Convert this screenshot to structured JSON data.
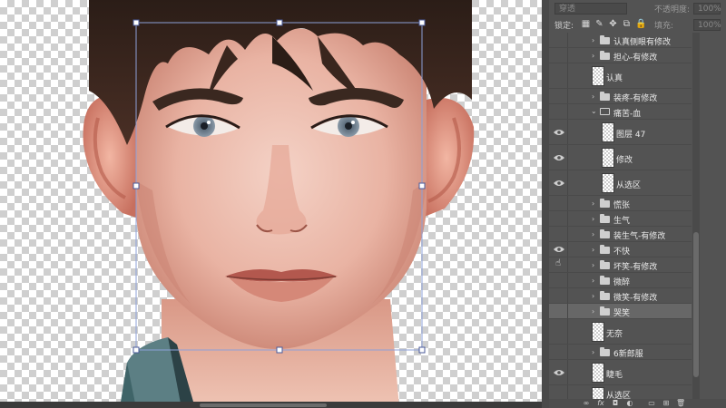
{
  "canvas": {
    "portrait": "illustrated male portrait",
    "transform_box": true
  },
  "panel": {
    "blend_mode": "穿透",
    "opacity_label": "不透明度:",
    "opacity_value": "100%",
    "lock_label": "锁定:",
    "fill_label": "填充:",
    "fill_value": "100%",
    "layers": [
      {
        "name": "认真侧眼有修改",
        "kind": "group",
        "visible": false,
        "expanded": false
      },
      {
        "name": "担心-有修改",
        "kind": "group",
        "visible": false,
        "expanded": false
      },
      {
        "name": "认真",
        "kind": "layer",
        "visible": false
      },
      {
        "name": "装疼-有修改",
        "kind": "group",
        "visible": false,
        "expanded": false
      },
      {
        "name": "痛苦-血",
        "kind": "group",
        "visible": false,
        "expanded": true
      },
      {
        "name": "图层 47",
        "kind": "layer",
        "visible": true
      },
      {
        "name": "修改",
        "kind": "layer",
        "visible": true
      },
      {
        "name": "从选区",
        "kind": "layer",
        "visible": true
      },
      {
        "name": "慌张",
        "kind": "group",
        "visible": false,
        "expanded": false
      },
      {
        "name": "生气",
        "kind": "group",
        "visible": false,
        "expanded": false
      },
      {
        "name": "装生气-有修改",
        "kind": "group",
        "visible": false,
        "expanded": false
      },
      {
        "name": "不快",
        "kind": "group",
        "visible": true,
        "expanded": false
      },
      {
        "name": "坏笑-有修改",
        "kind": "group",
        "visible": false,
        "expanded": false
      },
      {
        "name": "微醉",
        "kind": "group",
        "visible": false,
        "expanded": false
      },
      {
        "name": "微笑-有修改",
        "kind": "group",
        "visible": false,
        "expanded": false
      },
      {
        "name": "哭笑",
        "kind": "group",
        "visible": false,
        "expanded": false,
        "selected": true
      },
      {
        "name": "无奈",
        "kind": "layer",
        "visible": false
      },
      {
        "name": "6新郎服",
        "kind": "group",
        "visible": false,
        "expanded": false
      },
      {
        "name": "睫毛",
        "kind": "layer",
        "visible": true
      },
      {
        "name": "从选区",
        "kind": "layer",
        "visible": false
      }
    ],
    "bottom_icons": [
      "link-icon",
      "fx-icon",
      "mask-icon",
      "adjustment-icon",
      "new-group-icon",
      "new-layer-icon",
      "trash-icon"
    ]
  }
}
